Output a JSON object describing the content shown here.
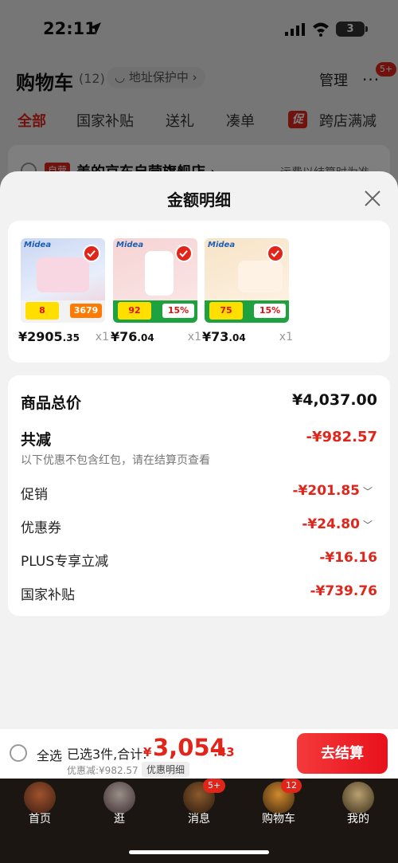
{
  "status_bar": {
    "time": "22:11",
    "battery": "3"
  },
  "cart_header": {
    "title": "购物车",
    "count": "(12)",
    "address_protect": "◡ 地址保护中 ›",
    "manage": "管理",
    "more": "···",
    "more_badge": "5+"
  },
  "filter_tabs": {
    "all": "全部",
    "national_subsidy": "国家补贴",
    "gift": "送礼",
    "bundle": "凑单",
    "cu_badge": "促",
    "cross_store": "跨店满减"
  },
  "store_row": {
    "tag": "自营",
    "name": "美的京东自营旗舰店 ›",
    "note": "运费以结算时为准"
  },
  "sheet": {
    "title": "金额明细",
    "products": [
      {
        "price_int": "¥2905",
        "price_dec": ".35",
        "qty": "x1",
        "brand": "Midea",
        "badge_left": "8",
        "badge_right": "3679"
      },
      {
        "price_int": "¥76",
        "price_dec": ".04",
        "qty": "x1",
        "brand": "Midea",
        "badge_left": "92",
        "badge_right": "15%"
      },
      {
        "price_int": "¥73",
        "price_dec": ".04",
        "qty": "x1",
        "brand": "Midea",
        "badge_left": "75",
        "badge_right": "15%"
      }
    ],
    "details": {
      "total_label": "商品总价",
      "total_value": "¥4,037.00",
      "reduce_label": "共减",
      "reduce_value": "-¥982.57",
      "reduce_note": "以下优惠不包含红包，请在结算页查看",
      "promo_label": "促销",
      "promo_value": "-¥201.85",
      "coupon_label": "优惠券",
      "coupon_value": "-¥24.80",
      "plus_label": "PLUS专享立减",
      "plus_value": "-¥16.16",
      "subsidy_label": "国家补贴",
      "subsidy_value": "-¥739.76"
    }
  },
  "checkout": {
    "select_all": "全选",
    "selected": "已选3件,合计:",
    "yen": "¥",
    "total_int": "3,054",
    "total_dec": ".43",
    "discount": "优惠减:¥982.57",
    "discount_detail": "优惠明细",
    "button": "去结算"
  },
  "tabbar": {
    "tabs": [
      {
        "label": "首页"
      },
      {
        "label": "逛"
      },
      {
        "label": "消息",
        "badge": "5+"
      },
      {
        "label": "购物车",
        "badge": "12"
      },
      {
        "label": "我的"
      }
    ]
  }
}
